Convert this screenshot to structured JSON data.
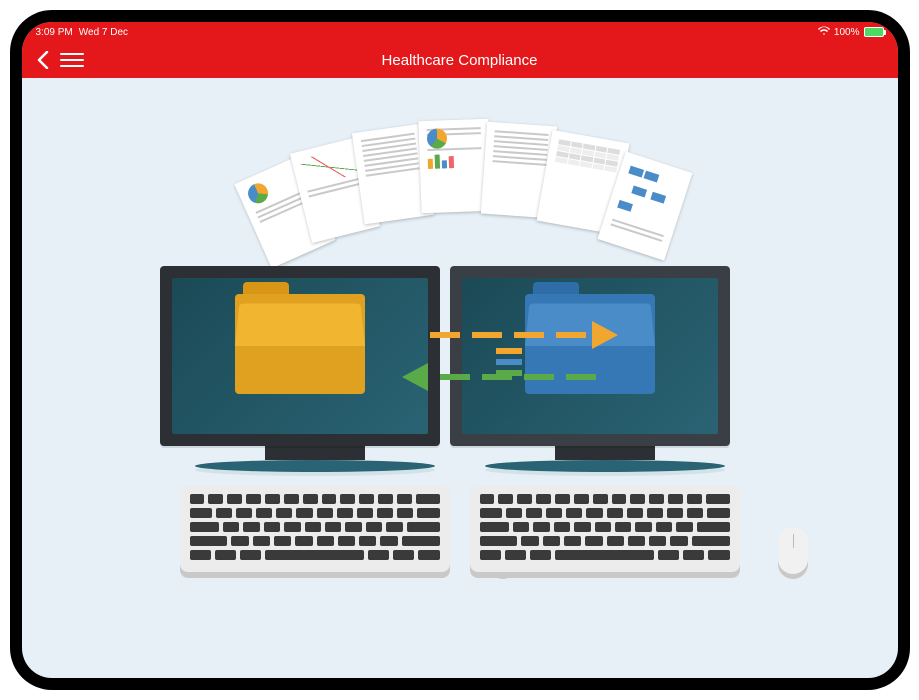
{
  "status": {
    "time": "3:09 PM",
    "date": "Wed 7 Dec",
    "battery_percent": "100%",
    "wifi_icon": "wifi",
    "charging": true
  },
  "nav": {
    "title": "Healthcare Compliance",
    "back_label": "Back",
    "menu_label": "Menu"
  },
  "illustration": {
    "description": "Two desktop computers exchanging document files; orange arrow points right, green arrow points left, assorted report pages fly between yellow and blue folders.",
    "left_folder_color": "yellow",
    "right_folder_color": "blue",
    "arrow_right_color": "#f0a62f",
    "arrow_left_color": "#5aaa4a"
  }
}
